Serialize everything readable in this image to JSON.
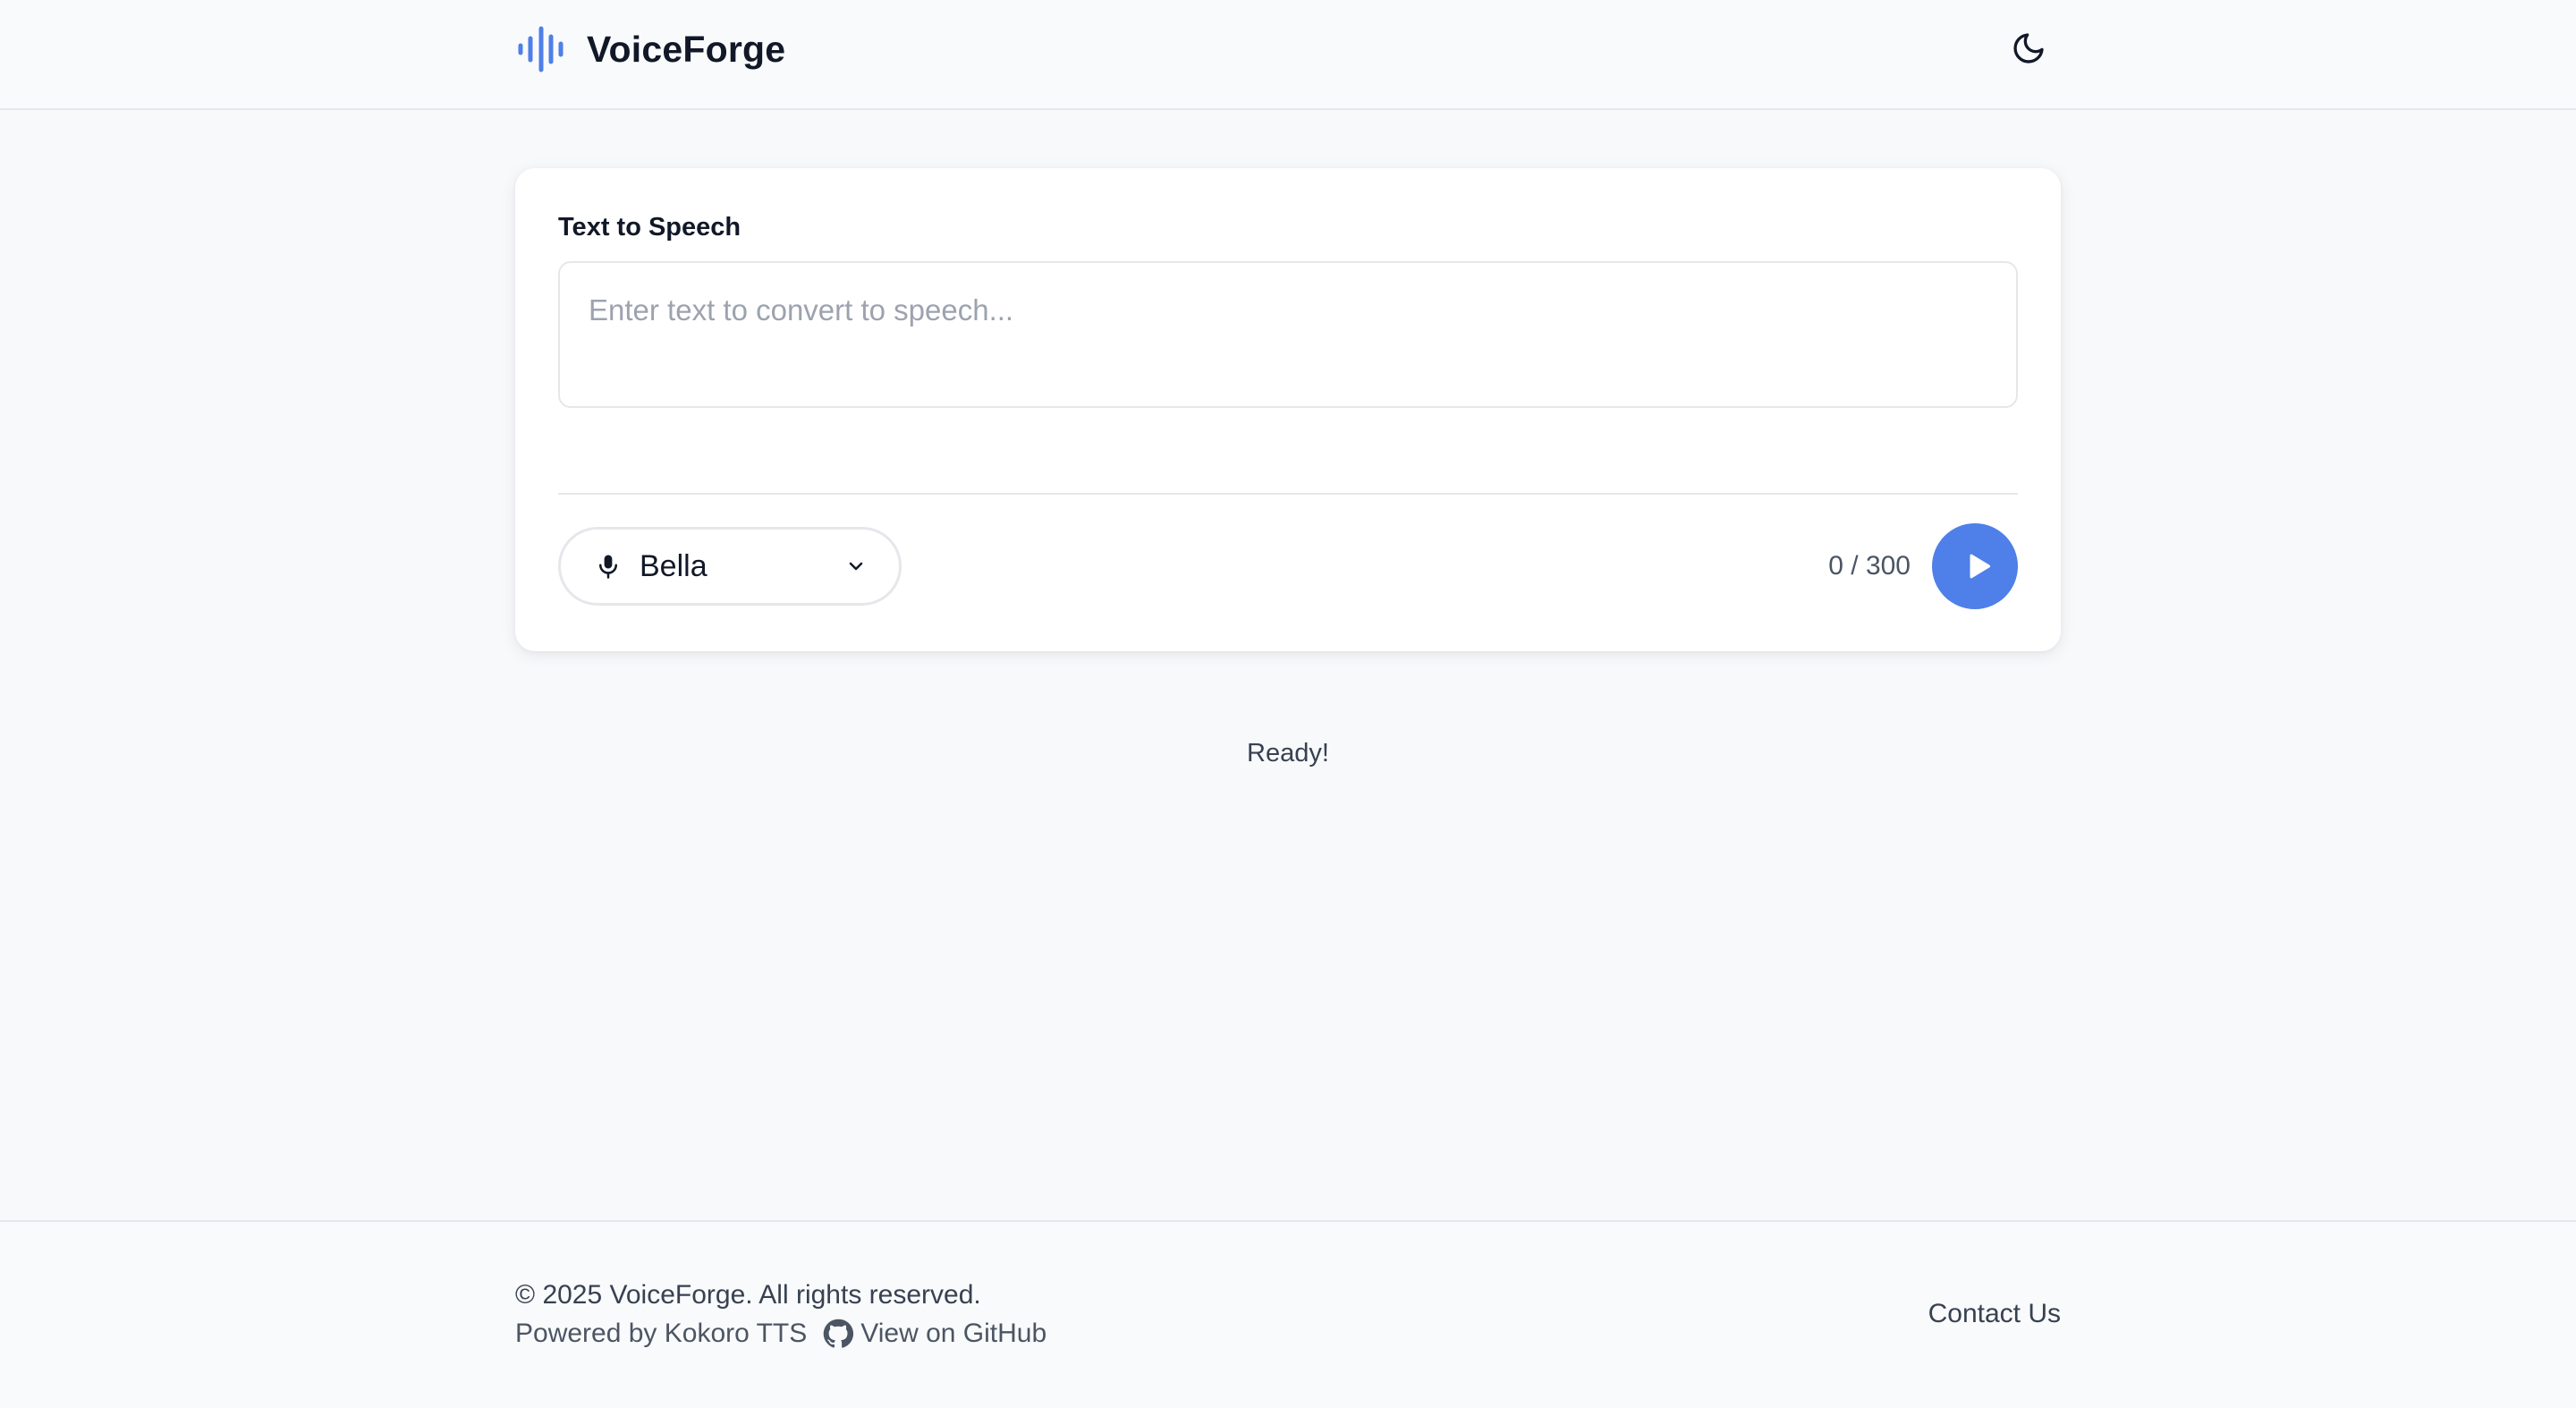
{
  "header": {
    "brand_name": "VoiceForge",
    "logo_icon": "audio-waveform-icon",
    "theme_toggle_icon": "moon-icon"
  },
  "card": {
    "label": "Text to Speech",
    "textarea": {
      "value": "",
      "placeholder": "Enter text to convert to speech..."
    },
    "voice_select": {
      "icon": "microphone-icon",
      "selected": "Bella",
      "chevron_icon": "chevron-down-icon"
    },
    "char_count": "0 / 300",
    "play_icon": "play-icon"
  },
  "status": {
    "text": "Ready!"
  },
  "footer": {
    "copyright": "© 2025 VoiceForge. All rights reserved.",
    "powered_by": "Powered by Kokoro TTS",
    "github_label": "View on GitHub",
    "github_icon": "github-icon",
    "contact_label": "Contact Us"
  },
  "colors": {
    "accent": "#4f7fe8",
    "background": "#f8f9fb",
    "card": "#ffffff",
    "border": "#e5e7eb",
    "text": "#111827",
    "muted_text": "#4b5563"
  }
}
